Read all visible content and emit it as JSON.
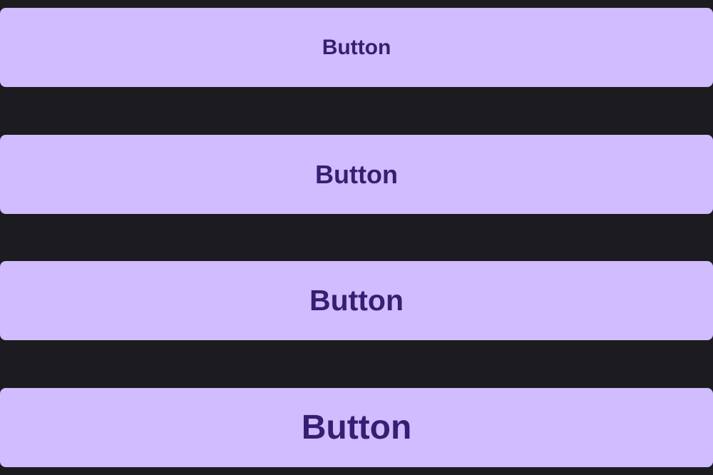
{
  "colors": {
    "background": "#1c1b1f",
    "button_fill": "#d0bcff",
    "button_text": "#381e72"
  },
  "buttons": [
    {
      "label": "Button"
    },
    {
      "label": "Button"
    },
    {
      "label": "Button"
    },
    {
      "label": "Button"
    }
  ]
}
